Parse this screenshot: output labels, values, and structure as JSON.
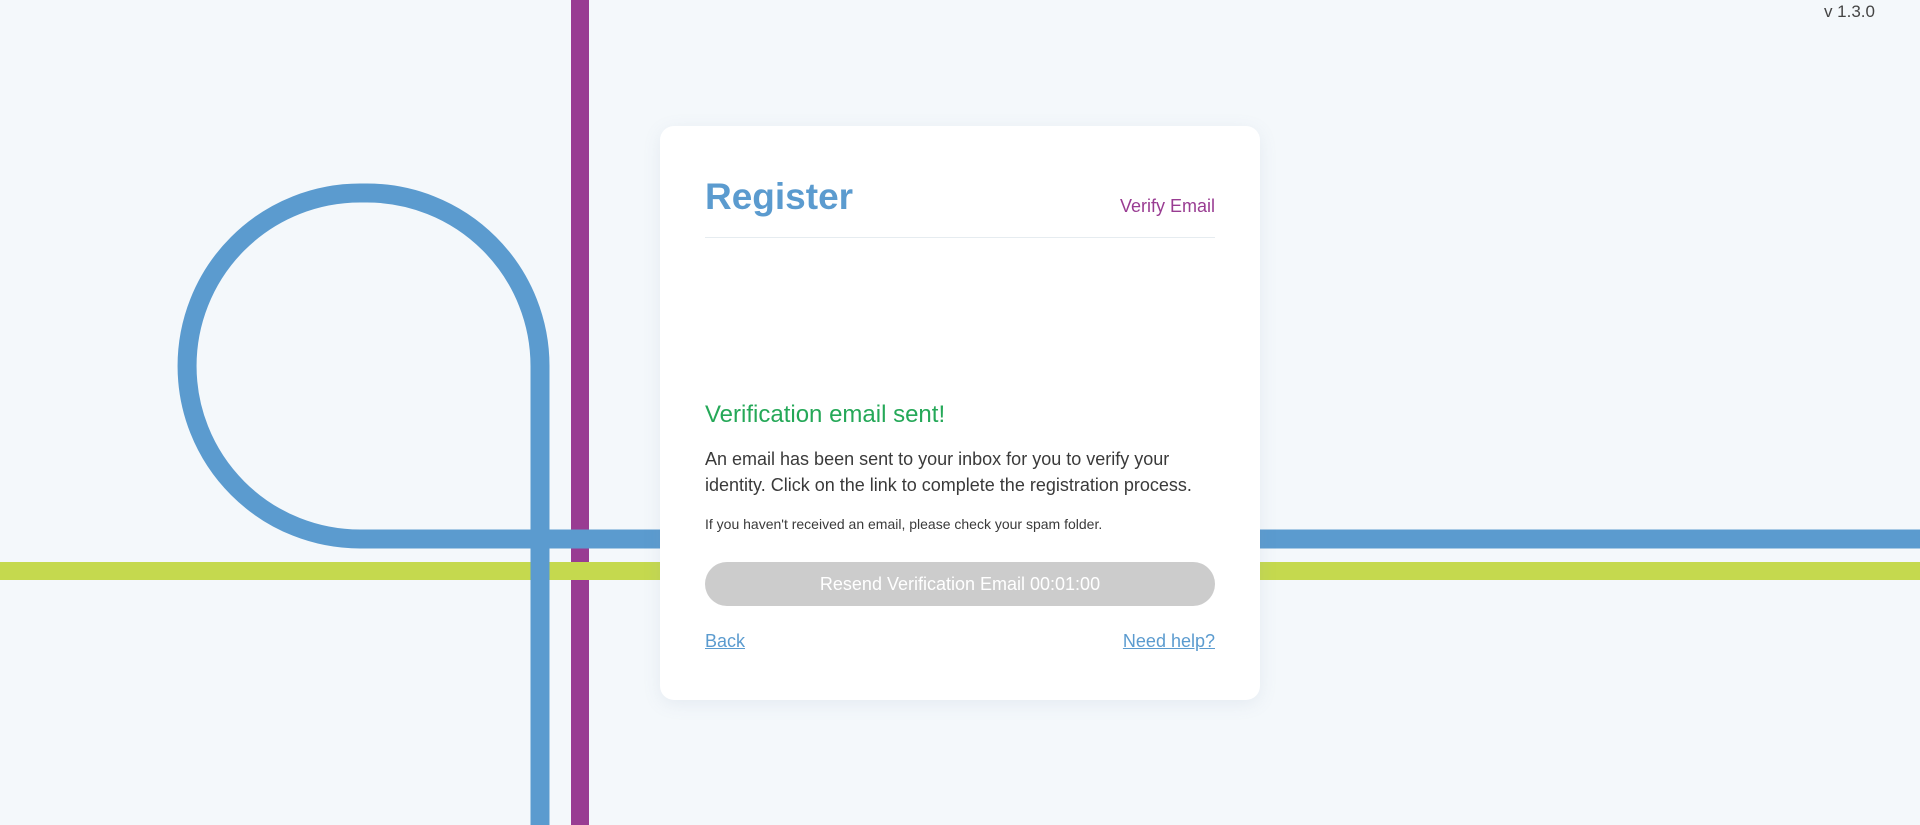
{
  "app": {
    "version": "v 1.3.0"
  },
  "colors": {
    "background": "#f4f8fb",
    "line_blue": "#5b9bcf",
    "line_purple": "#993c92",
    "line_green": "#c5d94e",
    "title_blue": "#5b9bcf",
    "step_purple": "#993c92",
    "success_green": "#25a858",
    "disabled_button": "#cccccc"
  },
  "card": {
    "title": "Register",
    "step_label": "Verify Email",
    "success_title": "Verification email sent!",
    "message": "An email has been sent to your inbox for you to verify your identity. Click on the link to complete the registration process.",
    "spam_note": "If you haven't received an email, please check your spam folder.",
    "resend_button": {
      "label": "Resend Verification Email 00:01:00",
      "disabled": true
    },
    "back_link": "Back",
    "help_link": "Need help?"
  }
}
